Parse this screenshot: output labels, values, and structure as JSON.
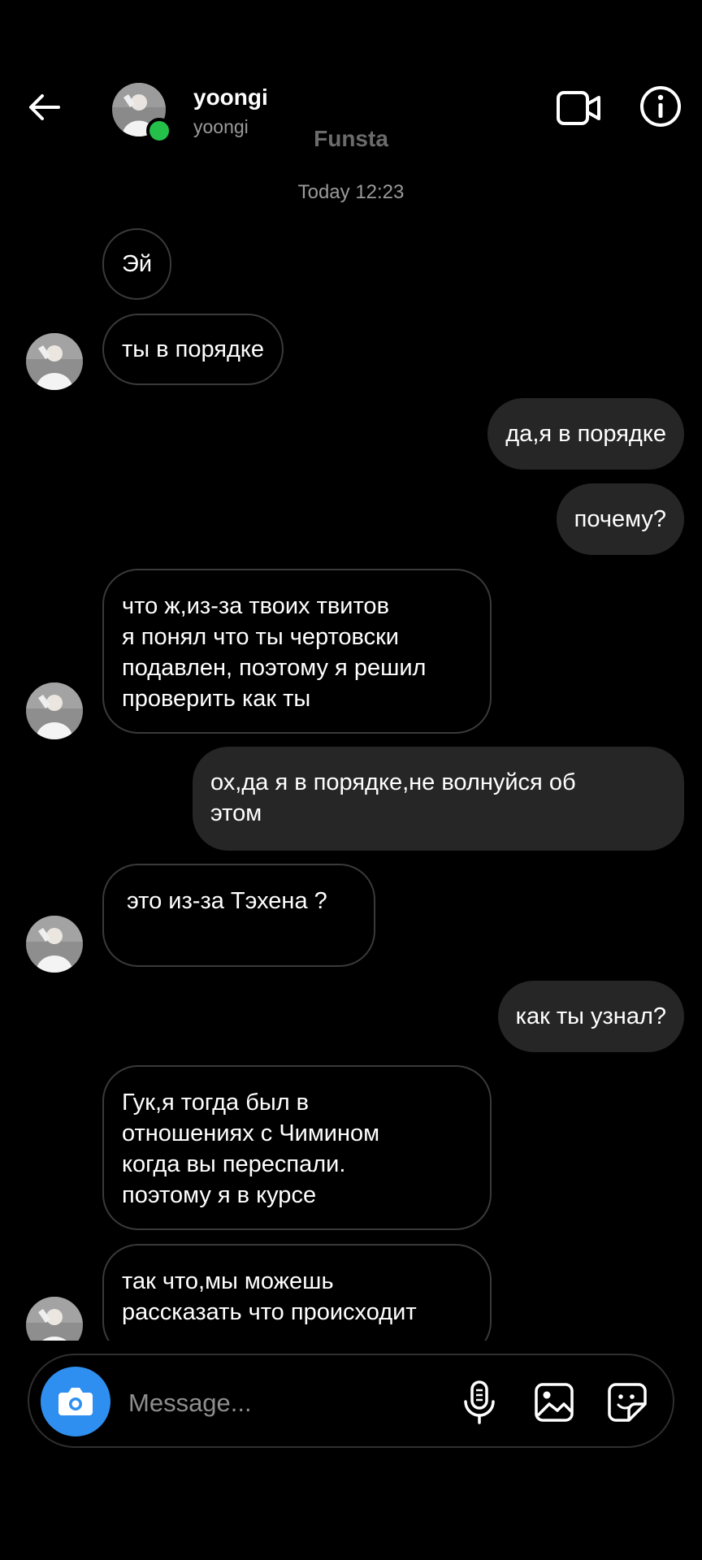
{
  "header": {
    "name": "yoongi",
    "username": "yoongi",
    "account_label": "Funsta"
  },
  "thread": {
    "timestamp": "Today 12:23",
    "messages": [
      {
        "from": "them",
        "text": "Эй"
      },
      {
        "from": "them",
        "text": "ты в порядке"
      },
      {
        "from": "me",
        "text": "да,я в порядке"
      },
      {
        "from": "me",
        "text": "почему?"
      },
      {
        "from": "them",
        "lines": [
          "что ж,из-за твоих твитов",
          "я понял что ты чертовски",
          "подавлен, поэтому я решил",
          "проверить как ты"
        ]
      },
      {
        "from": "me",
        "lines": [
          "ох,да я в порядке,не волнуйся об",
          "этом"
        ]
      },
      {
        "from": "them",
        "text": "это из-за Тэхена ?"
      },
      {
        "from": "me",
        "text": "как ты узнал?"
      },
      {
        "from": "them",
        "lines": [
          "Гук,я тогда был в",
          "отношениях с Чимином",
          "когда вы переспали.",
          "поэтому я в курсе"
        ]
      },
      {
        "from": "them",
        "lines": [
          "так что,мы можешь",
          "рассказать что происходит"
        ]
      }
    ]
  },
  "composer": {
    "placeholder": "Message..."
  },
  "colors": {
    "background": "#000000",
    "outgoing_bubble": "#262626",
    "incoming_border": "#3a3a3a",
    "camera_button": "#2e8ff0",
    "online_dot": "#25c04a"
  },
  "icons": [
    "back-arrow-icon",
    "video-call-icon",
    "info-icon",
    "camera-icon",
    "microphone-icon",
    "gallery-icon",
    "sticker-icon"
  ]
}
